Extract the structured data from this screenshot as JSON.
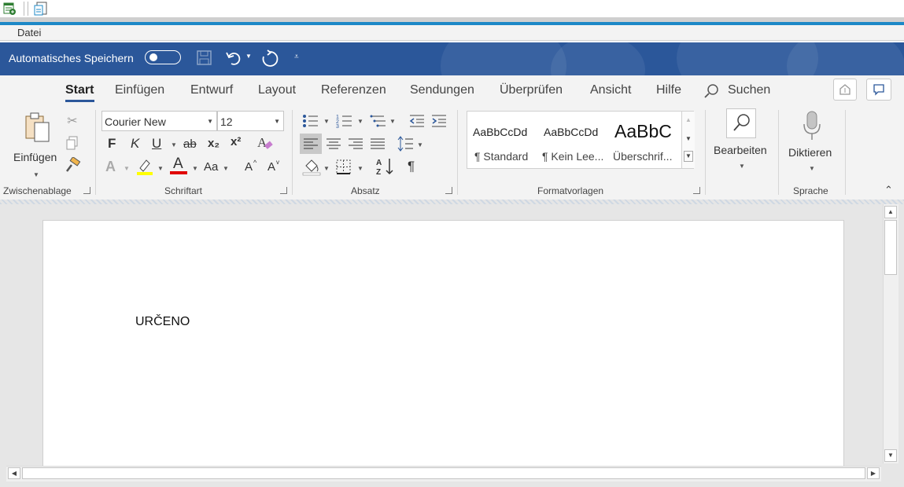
{
  "host": {
    "icon1": "sheet-add-icon",
    "icon2": "document-copy-icon"
  },
  "file_menu": {
    "label": "Datei"
  },
  "titlebar": {
    "autosave_label": "Automatisches Speichern",
    "autosave_on": false
  },
  "tabs": {
    "items": [
      {
        "label": "Start"
      },
      {
        "label": "Einfügen"
      },
      {
        "label": "Entwurf"
      },
      {
        "label": "Layout"
      },
      {
        "label": "Referenzen"
      },
      {
        "label": "Sendungen"
      },
      {
        "label": "Überprüfen"
      },
      {
        "label": "Ansicht"
      },
      {
        "label": "Hilfe"
      }
    ],
    "search_label": "Suchen"
  },
  "clipboard": {
    "paste_label": "Einfügen",
    "group_label": "Zwischenablage"
  },
  "font": {
    "name": "Courier New",
    "size": "12",
    "bold": "F",
    "italic": "K",
    "underline": "U",
    "strike": "ab",
    "subscript": "x₂",
    "superscript": "x²",
    "font_color_letter": "A",
    "case_label": "Aa",
    "grow": "A",
    "shrink": "A",
    "group_label": "Schriftart",
    "highlight_color": "#ffff00",
    "font_color": "#e00000"
  },
  "paragraph": {
    "group_label": "Absatz",
    "pilcrow": "¶"
  },
  "styles": {
    "items": [
      {
        "sample": "AaBbCcDd",
        "name": "¶ Standard"
      },
      {
        "sample": "AaBbCcDd",
        "name": "¶ Kein Lee..."
      },
      {
        "sample": "AaBbC",
        "name": "Überschrif..."
      }
    ],
    "group_label": "Formatvorlagen"
  },
  "editing": {
    "label": "Bearbeiten"
  },
  "voice": {
    "label": "Diktieren",
    "group_label": "Sprache"
  },
  "document": {
    "text": "URČENO"
  },
  "colors": {
    "brand_blue": "#2b579a",
    "accent": "#1d88c7"
  }
}
